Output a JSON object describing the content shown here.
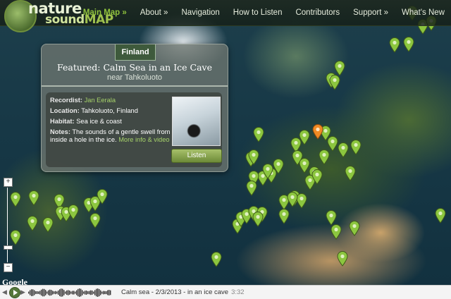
{
  "header": {
    "logo": {
      "word1": "nature",
      "word2a": "sound",
      "word2b": "MAP"
    },
    "nav": [
      {
        "label": "Main Map »",
        "active": true
      },
      {
        "label": "About »",
        "active": false
      },
      {
        "label": "Navigation",
        "active": false
      },
      {
        "label": "How to Listen",
        "active": false
      },
      {
        "label": "Contributors",
        "active": false
      },
      {
        "label": "Support »",
        "active": false
      },
      {
        "label": "What's New",
        "active": false
      }
    ]
  },
  "featured": {
    "country_tag": "Finland",
    "title": "Featured: Calm Sea in an Ice Cave",
    "subtitle": "near Tahkoluoto",
    "recordist_label": "Recordist:",
    "recordist": "Jan Eerala",
    "location_label": "Location:",
    "location": "Tahkoluoto, Finland",
    "habitat_label": "Habitat:",
    "habitat": "Sea ice & coast",
    "notes_label": "Notes:",
    "notes_line1": "The sounds of a gentle swell from",
    "notes_line2": "inside a hole in the ice.",
    "notes_link": "More info & video",
    "listen_label": "Listen"
  },
  "map": {
    "attribution": "Google",
    "zoom_in": "+",
    "zoom_out": "−",
    "marker_color": "#8cc63f",
    "active_marker_color": "#f08a24"
  },
  "player": {
    "track": "Calm sea - 2/3/2013 - in an ice cave",
    "time": "3:32"
  }
}
